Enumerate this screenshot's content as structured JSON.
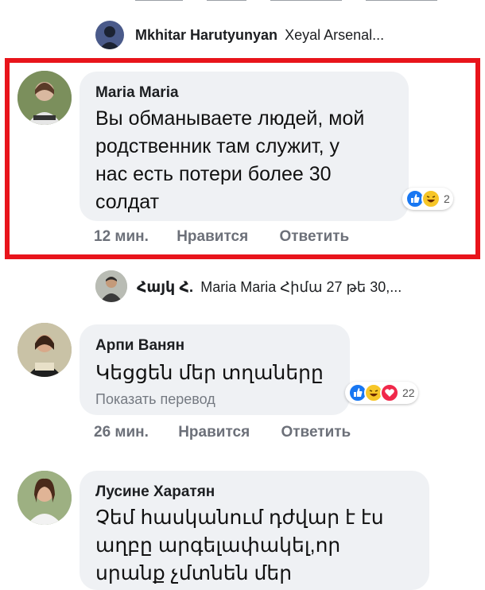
{
  "reply1": {
    "author": "Mkhitar Harutyunyan",
    "text": "Xeyal Arsenal..."
  },
  "comment1": {
    "author": "Maria Maria",
    "lines": [
      "Вы обманываете людей, мой",
      "родственник там служит, у",
      "нас есть потери более 30",
      "солдат"
    ],
    "reactions": "2",
    "time": "12 мин.",
    "like": "Нравится",
    "reply": "Ответить"
  },
  "reply2": {
    "author": "Հայկ Հ.",
    "text": "Maria Maria Հիմա 27 թե 30,..."
  },
  "comment2": {
    "author": "Арпи Ванян",
    "text": "Կեցցեն մեր տղաները",
    "translate": "Показать перевод",
    "reactions": "22",
    "time": "26 мин.",
    "like": "Нравится",
    "reply": "Ответить"
  },
  "comment3": {
    "author": "Лусине Харатян",
    "lines": [
      "Չեմ հասկանում դժվար է էս",
      "աղբը արգելափակել,որ",
      "սրանք չմտնեն մեր"
    ]
  },
  "colors": {
    "highlight": "#e8141b",
    "bubble": "#eff1f4",
    "like_blue": "#1877f2",
    "haha_yellow": "#f7c628",
    "love_red": "#f0284a"
  },
  "icons": [
    "like-reaction-icon",
    "haha-reaction-icon",
    "love-reaction-icon"
  ]
}
